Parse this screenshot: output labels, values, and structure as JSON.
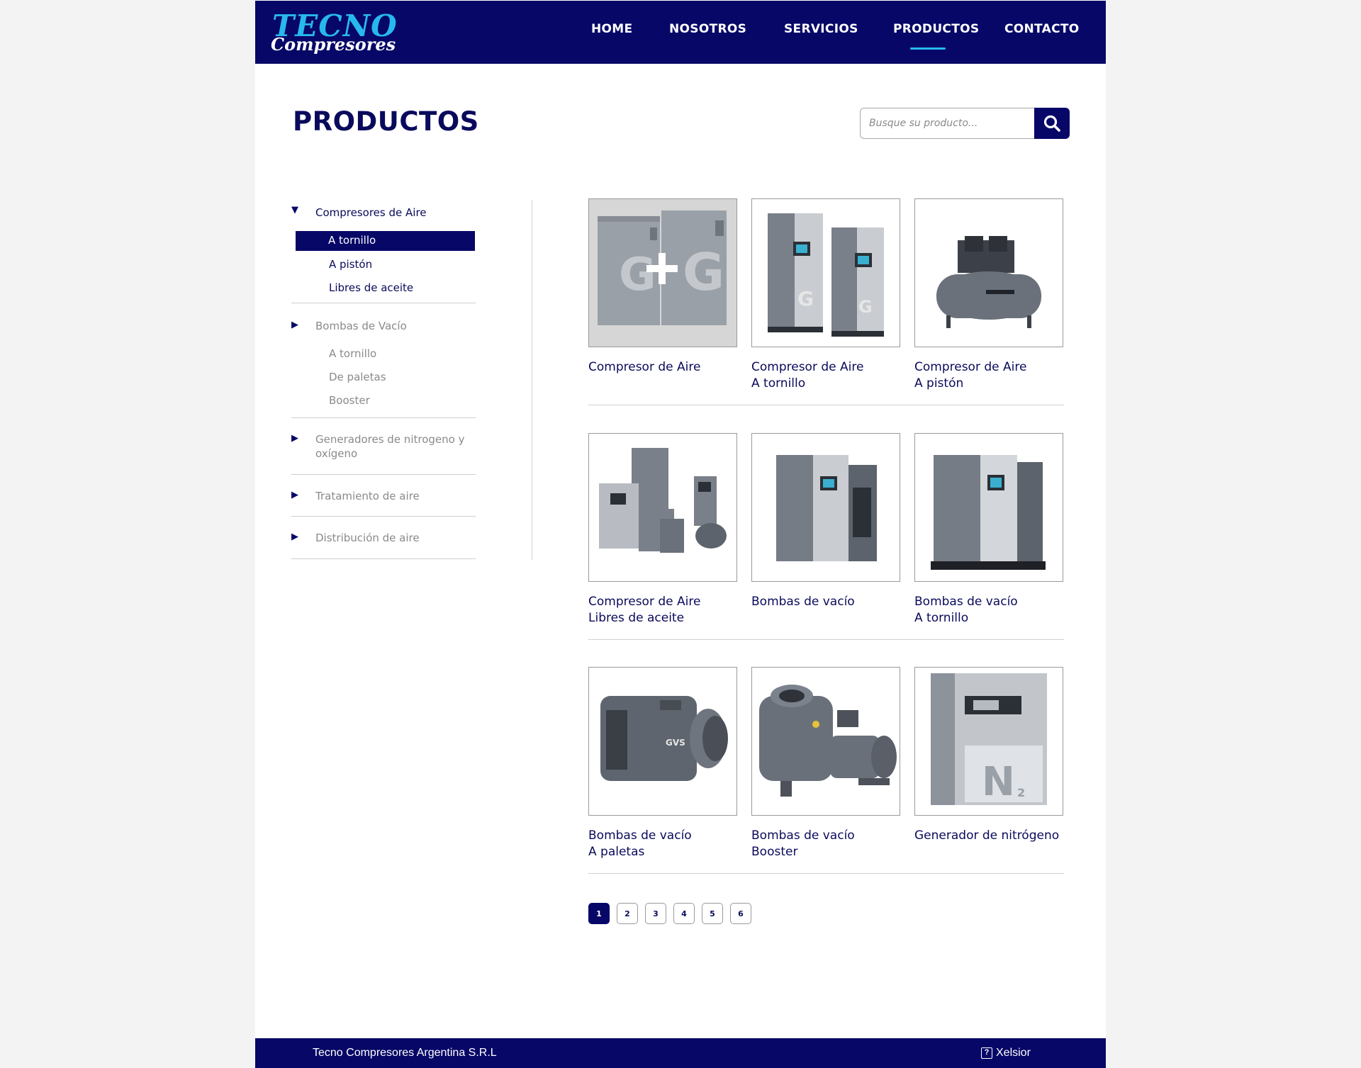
{
  "brand": {
    "line1": "TECNO",
    "line2": "Compresores",
    "primary_color": "#070768",
    "accent_color": "#27b8ee"
  },
  "nav": {
    "items": [
      "HOME",
      "NOSOTROS",
      "SERVICIOS",
      "PRODUCTOS",
      "CONTACTO"
    ],
    "active": "PRODUCTOS"
  },
  "page": {
    "title": "PRODUCTOS"
  },
  "search": {
    "placeholder": "Busque su producto...",
    "icon": "search-icon"
  },
  "sidebar": {
    "categories": [
      {
        "label": "Compresores de Aire",
        "expanded": true,
        "items": [
          "A tornillo",
          "A pistón",
          "Libres de aceite"
        ],
        "selected": "A tornillo"
      },
      {
        "label": "Bombas de Vacío",
        "expanded": false,
        "items": [
          "A tornillo",
          "De paletas",
          "Booster"
        ]
      },
      {
        "label": "Generadores de nitrogeno y oxígeno",
        "expanded": false,
        "items": []
      },
      {
        "label": "Tratamiento de aire",
        "expanded": false,
        "items": []
      },
      {
        "label": "Distribución de aire",
        "expanded": false,
        "items": []
      }
    ]
  },
  "products": [
    {
      "line1": "Compresor de Aire",
      "line2": "",
      "image": "compressor-pair-image"
    },
    {
      "line1": "Compresor de Aire",
      "line2": "A tornillo",
      "image": "screw-compressor-image"
    },
    {
      "line1": "Compresor de Aire",
      "line2": "A pistón",
      "image": "piston-compressor-image"
    },
    {
      "line1": "Compresor de Aire",
      "line2": "Libres de aceite",
      "image": "oil-free-compressor-image"
    },
    {
      "line1": "Bombas de vacío",
      "line2": "",
      "image": "vacuum-pump-image"
    },
    {
      "line1": "Bombas de vacío",
      "line2": "A tornillo",
      "image": "screw-vacuum-pump-image"
    },
    {
      "line1": "Bombas de vacío",
      "line2": "A paletas",
      "image": "vane-vacuum-pump-image"
    },
    {
      "line1": "Bombas de vacío",
      "line2": "Booster",
      "image": "booster-pump-image"
    },
    {
      "line1": "Generador de nitrógeno",
      "line2": "",
      "image": "nitrogen-generator-image"
    }
  ],
  "pagination": {
    "pages": [
      "1",
      "2",
      "3",
      "4",
      "5",
      "6"
    ],
    "current": "1"
  },
  "footer": {
    "company": "Tecno Compresores Argentina S.R.L",
    "credit": "Xelsior"
  }
}
